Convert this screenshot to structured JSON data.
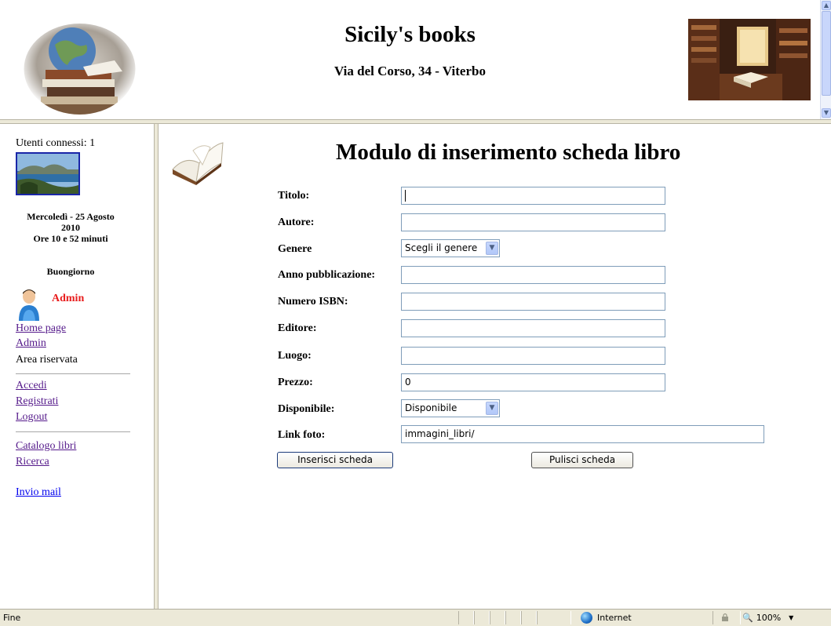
{
  "header": {
    "title": "Sicily's books",
    "address": "Via del Corso, 34 - Viterbo"
  },
  "sidebar": {
    "users_online": "Utenti connessi: 1",
    "date_line1": "Mercoledì - 25 Agosto",
    "date_line2": "2010",
    "time": "Ore 10 e 52 minuti",
    "greeting": "Buongiorno",
    "username": "Admin",
    "links_group1": [
      "Home page",
      "Admin"
    ],
    "reserved_area": "Area riservata",
    "links_group2": [
      "Accedi",
      "Registrati",
      "Logout"
    ],
    "links_group3": [
      "Catalogo libri",
      "Ricerca"
    ],
    "mail_link": "Invio mail"
  },
  "form": {
    "title": "Modulo di inserimento scheda libro",
    "fields": {
      "titolo": {
        "label": "Titolo:",
        "value": ""
      },
      "autore": {
        "label": "Autore:",
        "value": ""
      },
      "genere": {
        "label": "Genere",
        "value": "Scegli il genere"
      },
      "anno": {
        "label": "Anno pubblicazione:",
        "value": ""
      },
      "isbn": {
        "label": "Numero ISBN:",
        "value": ""
      },
      "editore": {
        "label": "Editore:",
        "value": ""
      },
      "luogo": {
        "label": "Luogo:",
        "value": ""
      },
      "prezzo": {
        "label": "Prezzo:",
        "value": "0"
      },
      "disponibile": {
        "label": "Disponibile:",
        "value": "Disponibile"
      },
      "link_foto": {
        "label": "Link foto:",
        "value": "immagini_libri/"
      }
    },
    "submit_label": "Inserisci scheda",
    "reset_label": "Pulisci scheda"
  },
  "statusbar": {
    "status": "Fine",
    "zone": "Internet",
    "zoom": "100%"
  },
  "icons": {
    "globe": "globe-icon",
    "book": "open-book-icon",
    "avatar": "user-avatar-icon"
  }
}
